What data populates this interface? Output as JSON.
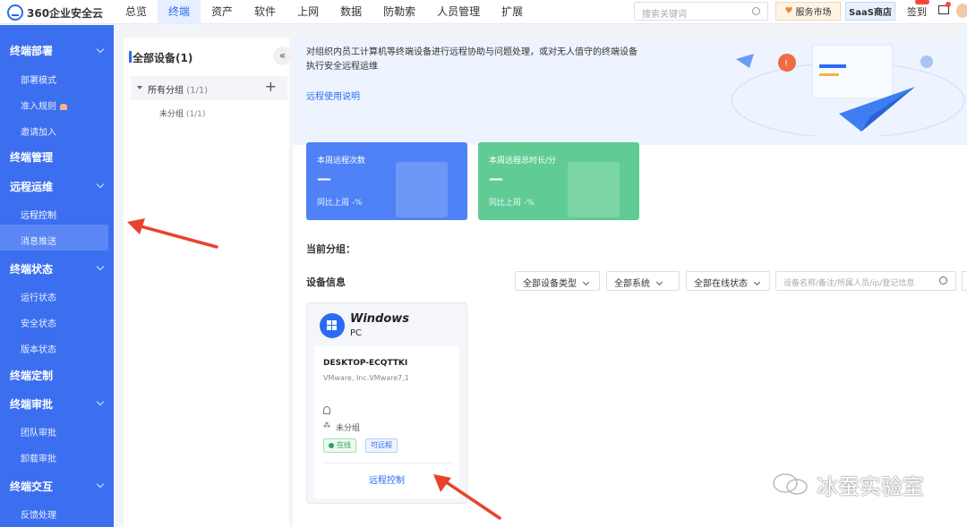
{
  "app": {
    "logo_text": "360企业安全云"
  },
  "topnav": {
    "items": [
      "总览",
      "终端",
      "资产",
      "软件",
      "上网",
      "数据",
      "防勒索",
      "人员管理",
      "扩展"
    ],
    "active": "终端"
  },
  "header": {
    "search_placeholder": "搜索关键词",
    "service_market": "服务市场",
    "saas_store": "SaaS商店",
    "signin": "签到"
  },
  "sidebar": {
    "groups": [
      {
        "label": "终端部署",
        "items": [
          "部署模式",
          "准入规则",
          "邀请加入"
        ]
      },
      {
        "label": "终端管理",
        "items": []
      },
      {
        "label": "远程运维",
        "items": [
          "远程控制",
          "消息推送"
        ]
      },
      {
        "label": "终端状态",
        "items": [
          "运行状态",
          "安全状态",
          "版本状态"
        ]
      },
      {
        "label": "终端定制",
        "items": []
      },
      {
        "label": "终端审批",
        "items": [
          "团队审批",
          "卸载审批"
        ]
      },
      {
        "label": "终端交互",
        "items": [
          "反馈处理"
        ]
      }
    ],
    "active_item": "远程控制"
  },
  "tree": {
    "title": "全部设备(1)",
    "collapse_glyph": "«",
    "all_groups": "所有分组",
    "all_groups_count": "(1/1)",
    "sub_group": "未分组",
    "sub_group_count": "(1/1)"
  },
  "hero": {
    "description": "对组织内员工计算机等终端设备进行远程协助与问题处理，或对无人值守的终端设备执行安全远程运维",
    "link": "远程使用说明"
  },
  "stats": [
    {
      "title": "本周远程次数",
      "value": "—",
      "sub": "同比上周 -%",
      "color": "#4e82f6"
    },
    {
      "title": "本周远程总时长/分",
      "value": "—",
      "sub": "同比上周 -%",
      "color": "#60cc94"
    }
  ],
  "section": {
    "current_group": "当前分组：",
    "device_info": "设备信息"
  },
  "filters": {
    "device_type": "全部设备类型",
    "system": "全部系统",
    "online_status": "全部在线状态",
    "search_placeholder": "设备名称/备注/所属人员/ip/登记信息"
  },
  "device": {
    "os": "Windows",
    "type": "PC",
    "hostname": "DESKTOP-ECQTTKI",
    "vendor": "VMware, Inc.VMware7,1",
    "group": "未分组",
    "status": "在线",
    "remote_tag": "可远程",
    "action": "远程控制"
  },
  "watermark": "冰蚕实验室"
}
